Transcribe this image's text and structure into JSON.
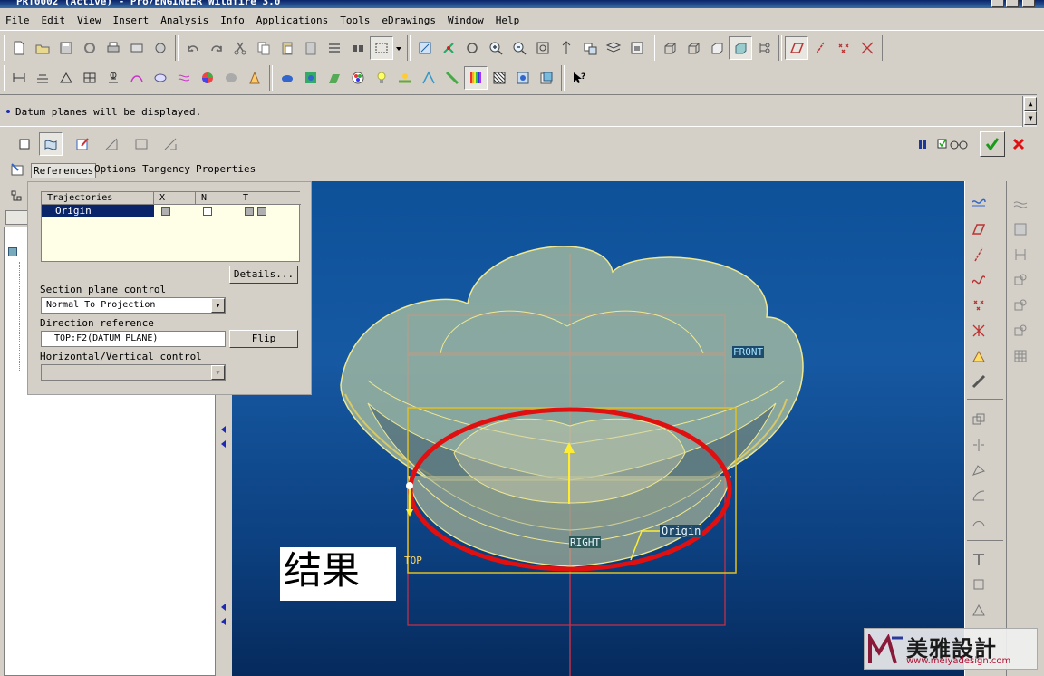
{
  "window": {
    "title": "PRT0002 (Active) - Pro/ENGINEER Wildfire 3.0"
  },
  "menu": [
    "File",
    "Edit",
    "View",
    "Insert",
    "Analysis",
    "Info",
    "Applications",
    "Tools",
    "eDrawings",
    "Window",
    "Help"
  ],
  "message": {
    "text": "Datum planes will be displayed."
  },
  "dashboard": {
    "tabs": [
      "References",
      "Options",
      "Tangency",
      "Properties"
    ]
  },
  "references_panel": {
    "table_headers": [
      "Trajectories",
      "X",
      "N",
      "T"
    ],
    "row_name": "Origin",
    "details_label": "Details...",
    "section_plane_label": "Section plane control",
    "section_plane_value": "Normal To Projection",
    "direction_ref_label": "Direction reference",
    "direction_ref_value": "TOP:F2(DATUM PLANE)",
    "flip_label": "Flip",
    "hv_control_label": "Horizontal/Vertical control",
    "hv_control_value": ""
  },
  "viewport": {
    "datum_labels": {
      "front": "FRONT",
      "right": "RIGHT",
      "top": "TOP",
      "origin": "Origin"
    }
  },
  "annotation": {
    "result_text": "结果"
  },
  "logo": {
    "text": "美雅設計",
    "url": "www.meiyadesign.com"
  },
  "colors": {
    "background": "#d4d0c8",
    "viewport_top": "#0d5199",
    "viewport_bottom": "#062a5c",
    "selection": "#0a246a",
    "highlight_ellipse": "#e01010",
    "model_edge": "#f0e890",
    "datum": "#c0304a",
    "accept": "#1a9a1a",
    "cancel": "#e01010"
  }
}
